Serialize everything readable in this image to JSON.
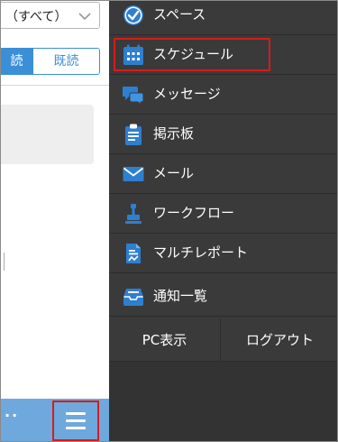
{
  "left_panel": {
    "filter_select_value": "（すべて）",
    "segment_unread": "読",
    "segment_read": "既読",
    "bottom_dots": "··"
  },
  "drawer": {
    "items": [
      {
        "label": "スペース",
        "icon": "space-icon"
      },
      {
        "label": "スケジュール",
        "icon": "calendar-icon"
      },
      {
        "label": "メッセージ",
        "icon": "message-icon"
      },
      {
        "label": "掲示板",
        "icon": "bulletin-board-icon"
      },
      {
        "label": "メール",
        "icon": "mail-icon"
      },
      {
        "label": "ワークフロー",
        "icon": "workflow-icon"
      },
      {
        "label": "マルチレポート",
        "icon": "multi-report-icon"
      },
      {
        "label": "通知一覧",
        "icon": "notification-list-icon"
      }
    ],
    "pc_view_label": "PC表示",
    "logout_label": "ログアウト"
  },
  "colors": {
    "drawer_background": "#3a3a3a",
    "accent_blue": "#3b8fd6",
    "bottom_bar_blue": "#6fa8dc",
    "highlight_red": "#d71b1b"
  }
}
